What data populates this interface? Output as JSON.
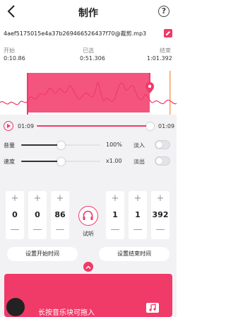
{
  "header": {
    "title": "制作",
    "help_glyph": "?"
  },
  "file": {
    "name": "4aef5175015e4a37b269466526437f70@裁剪.mp3"
  },
  "times": {
    "start_label": "开始",
    "start_value": "0:10.86",
    "selected_label": "已选",
    "selected_value": "0:51.306",
    "end_label": "结束",
    "end_value": "1:01.392"
  },
  "player": {
    "current": "01:09",
    "total": "01:09",
    "progress": 1.0
  },
  "volume": {
    "label": "音量",
    "value": "100%",
    "level": 0.5,
    "fade_in_label": "淡入"
  },
  "speed": {
    "label": "速度",
    "value": "x1.00",
    "level": 0.5,
    "fade_out_label": "淡出"
  },
  "start_steppers": [
    "0",
    "0",
    "86"
  ],
  "end_steppers": [
    "1",
    "1",
    "392"
  ],
  "stepper_plus": "+",
  "stepper_minus": "—",
  "listen_label": "试听",
  "set_start_label": "设置开始时间",
  "set_end_label": "设置结束时间",
  "drag_hint": "长按音乐块可拖入",
  "colors": {
    "accent": "#f03a68",
    "selection": "#f4557e"
  }
}
